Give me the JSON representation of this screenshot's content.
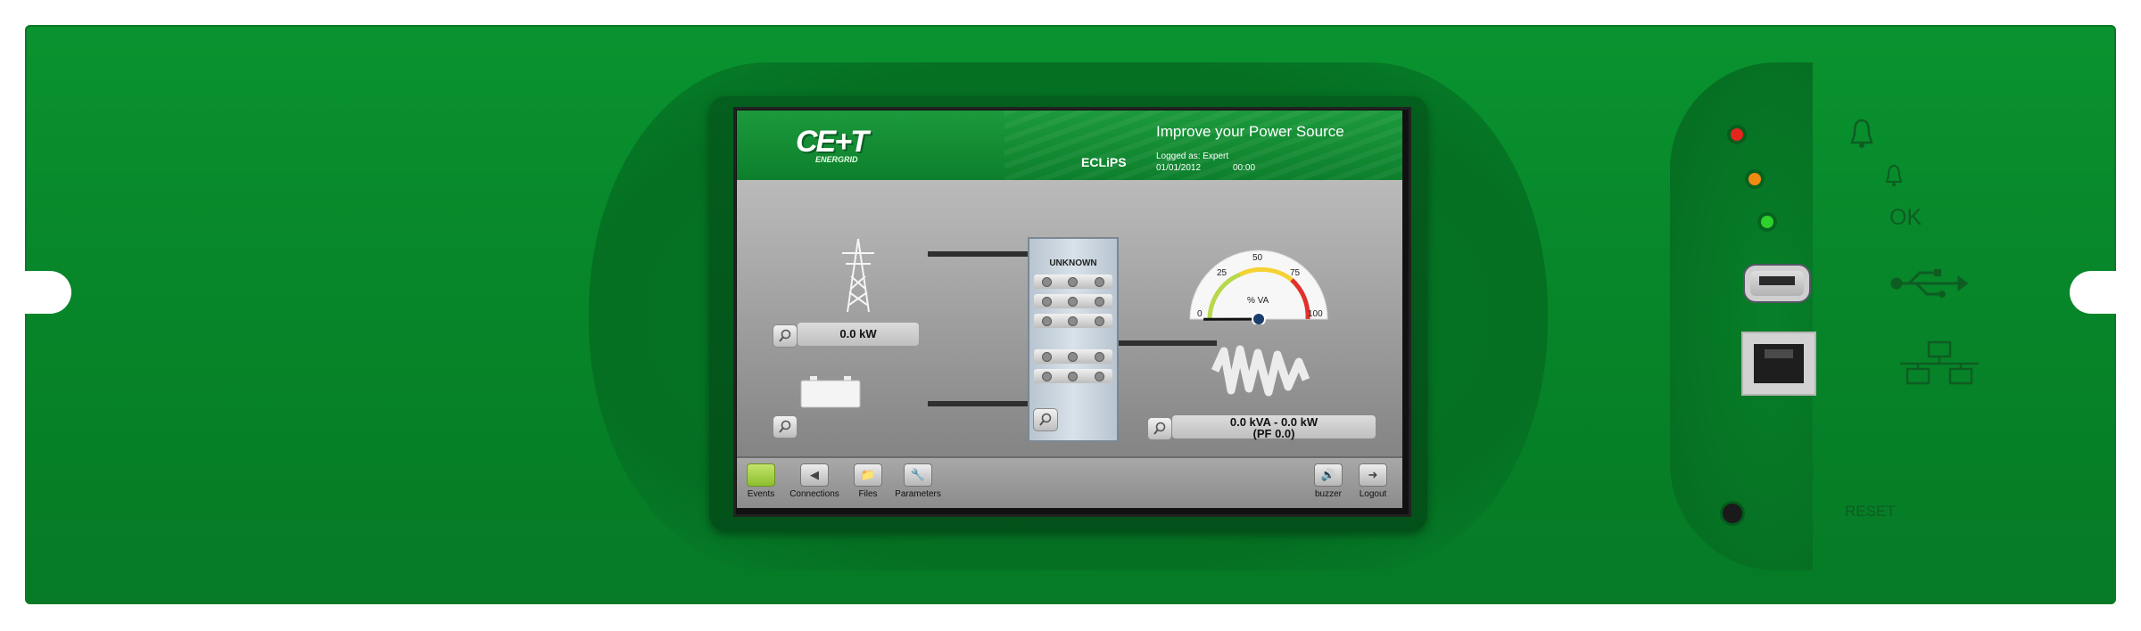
{
  "header": {
    "logo": "CE+T",
    "logo_sub": "ENERGRID",
    "tagline": "Improve your Power Source",
    "product": "ECLiPS",
    "logged_as": "Logged as: Expert",
    "date": "01/01/2012",
    "time": "00:00"
  },
  "diagram": {
    "grid_value": "0.0 kW",
    "switchboard_status": "UNKNOWN",
    "gauge": {
      "ticks": [
        "0",
        "25",
        "50",
        "75",
        "100"
      ],
      "unit": "% VA",
      "level_percent": 0
    },
    "load_value_line1": "0.0 kVA - 0.0 kW",
    "load_value_line2": "(PF 0.0)"
  },
  "toolbar": {
    "events": "Events",
    "connections": "Connections",
    "files": "Files",
    "parameters": "Parameters",
    "buzzer": "buzzer",
    "logout": "Logout"
  },
  "panel": {
    "ok_label": "OK",
    "reset_label": "RESET",
    "led_colors": {
      "red": "#e5261d",
      "orange": "#f08a10",
      "green": "#2ed12a"
    }
  }
}
